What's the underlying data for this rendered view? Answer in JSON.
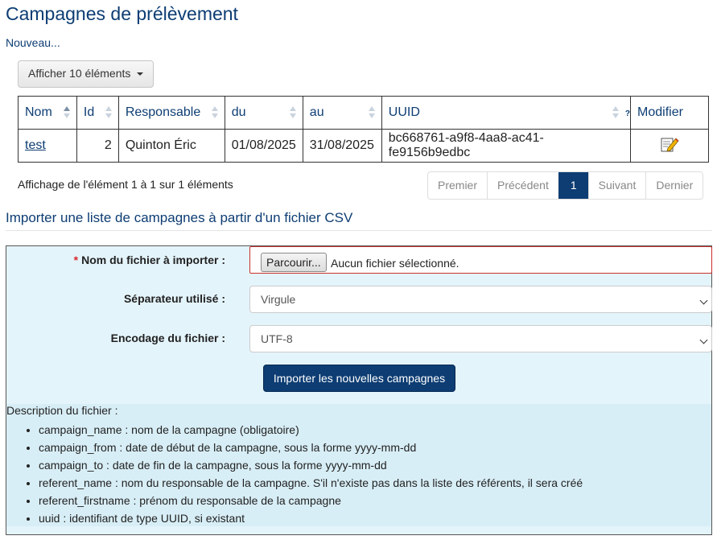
{
  "page": {
    "title": "Campagnes de prélèvement",
    "new_link": "Nouveau..."
  },
  "table": {
    "length_menu": "Afficher 10 éléments",
    "columns": [
      "Nom",
      "Id",
      "Responsable",
      "du",
      "au",
      "UUID",
      "Modifier"
    ],
    "help_mark": "?",
    "rows": [
      {
        "nom": "test",
        "id": "2",
        "responsable": "Quinton Éric",
        "du": "01/08/2025",
        "au": "31/08/2025",
        "uuid": "bc668761-a9f8-4aa8-ac41-fe9156b9edbc",
        "modifier_icon": "edit-icon"
      }
    ],
    "info": "Affichage de l'élément 1 à 1 sur 1 éléments",
    "pagination": {
      "first": "Premier",
      "previous": "Précédent",
      "current": "1",
      "next": "Suivant",
      "last": "Dernier"
    }
  },
  "import": {
    "title": "Importer une liste de campagnes à partir d'un fichier CSV",
    "file_label": "Nom du fichier à importer :",
    "required_mark": "*",
    "browse_button": "Parcourir...",
    "no_file": "Aucun fichier sélectionné.",
    "separator_label": "Séparateur utilisé :",
    "separator_value": "Virgule",
    "encoding_label": "Encodage du fichier :",
    "encoding_value": "UTF-8",
    "submit": "Importer les nouvelles campagnes",
    "description_title": "Description du fichier :",
    "description_items": [
      "campaign_name : nom de la campagne (obligatoire)",
      "campaign_from : date de début de la campagne, sous la forme yyyy-mm-dd",
      "campaign_to : date de fin de la campagne, sous la forme yyyy-mm-dd",
      "referent_name : nom du responsable de la campagne. S'il n'existe pas dans la liste des référents, il sera créé",
      "referent_firstname : prénom du responsable de la campagne",
      "uuid : identifiant de type UUID, si existant"
    ]
  },
  "colors": {
    "accent": "#0d3d73",
    "form_background": "#e4f4fb",
    "required": "#d9272e"
  }
}
